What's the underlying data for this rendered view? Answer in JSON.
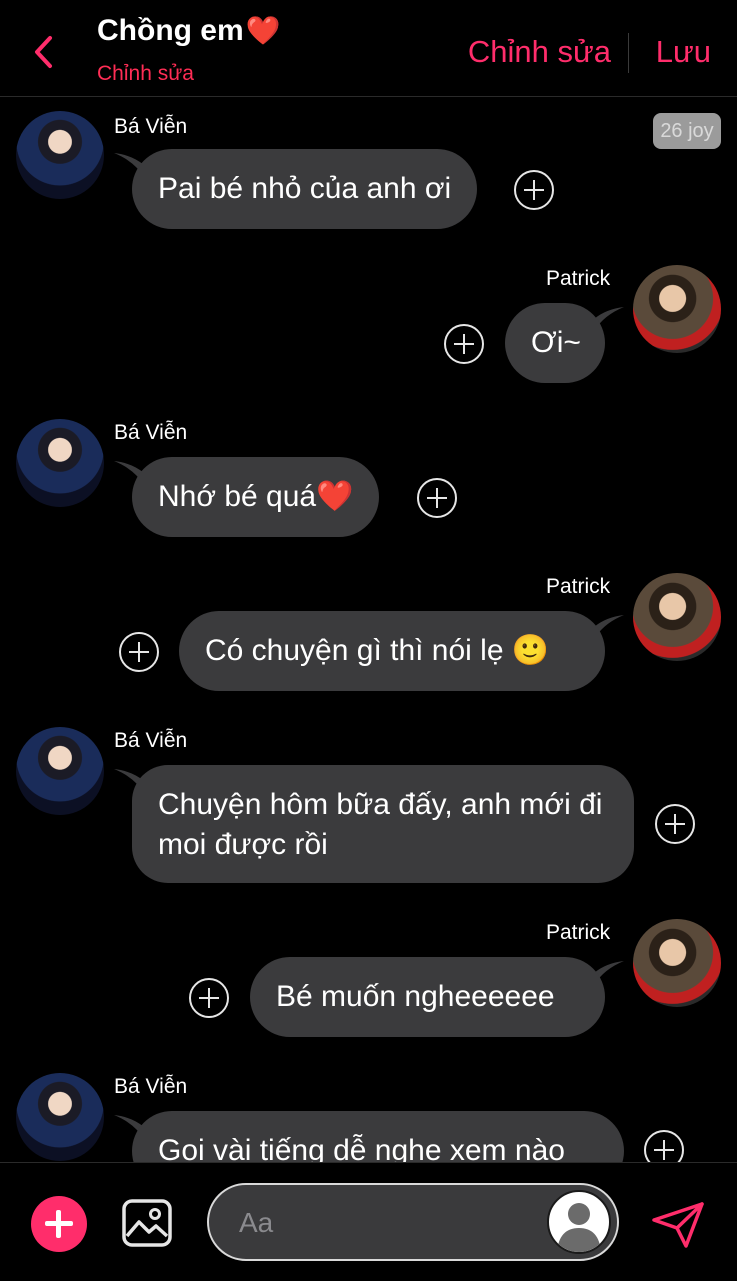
{
  "header": {
    "title": "Chồng em",
    "title_emoji": "❤️",
    "subtitle": "Chỉnh sửa",
    "edit_label": "Chỉnh sửa",
    "save_label": "Lưu"
  },
  "badge": "26 joy",
  "messages": [
    {
      "side": "left",
      "sender": "Bá Viễn",
      "text": "Pai bé nhỏ của anh ơi"
    },
    {
      "side": "right",
      "sender": "Patrick",
      "text": "Ơi~"
    },
    {
      "side": "left",
      "sender": "Bá Viễn",
      "text": "Nhớ bé quá❤️"
    },
    {
      "side": "right",
      "sender": "Patrick",
      "text": "Có chuyện gì thì nói lẹ 🙂"
    },
    {
      "side": "left",
      "sender": "Bá Viễn",
      "text": "Chuyện hôm bữa đấy, anh mới đi moi được rồi"
    },
    {
      "side": "right",
      "sender": "Patrick",
      "text": "Bé muốn ngheeeeee"
    },
    {
      "side": "left",
      "sender": "Bá Viễn",
      "text": "Gọi vài tiếng dễ nghe xem nào"
    }
  ],
  "composer": {
    "placeholder": "Aa"
  },
  "colors": {
    "accent": "#ff2d6b",
    "bubble": "#3b3b3d",
    "background": "#000000"
  },
  "icons": {
    "back": "chevron-left-icon",
    "add": "plus-icon",
    "image": "image-icon",
    "profile": "person-icon",
    "send": "send-icon"
  }
}
